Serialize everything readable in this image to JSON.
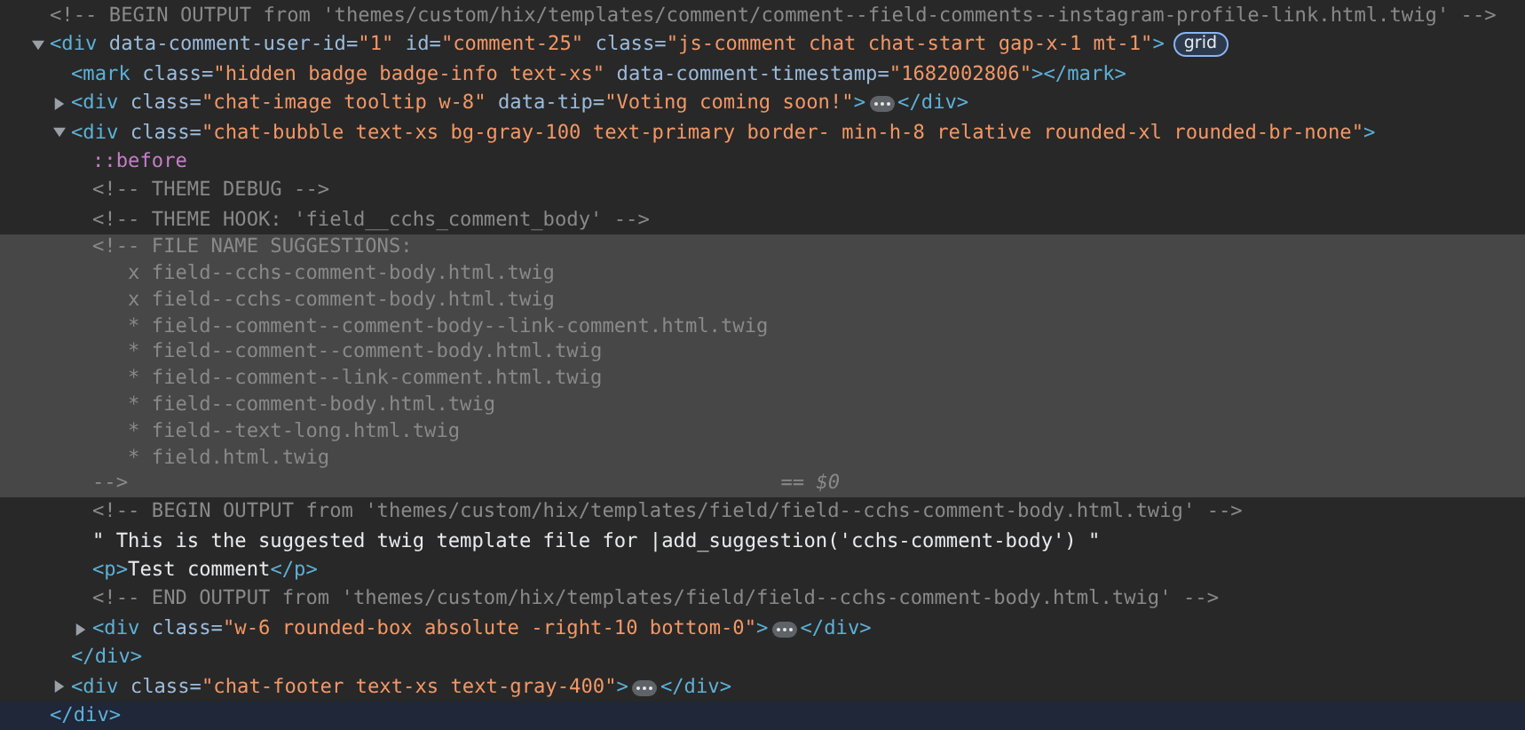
{
  "nodes": [
    {
      "kind": "comment",
      "selected": false,
      "lines": [
        "<!-- BEGIN OUTPUT from 'themes/custom/hix/templates/comment/comment--field-comments--instagram-profile-link.html.twig' -->"
      ]
    },
    {
      "kind": "element",
      "selected": false,
      "expanded": true,
      "badge": "grid",
      "closing_hovered": true,
      "tokens": [
        {
          "kind": "tag",
          "text": "<div"
        },
        {
          "kind": "attr",
          "text": " data-comment-user-id="
        },
        {
          "kind": "value",
          "text": "\"1\""
        },
        {
          "kind": "attr",
          "text": " id="
        },
        {
          "kind": "value",
          "text": "\"comment-25\""
        },
        {
          "kind": "attr",
          "text": " class="
        },
        {
          "kind": "value",
          "text": "\"js-comment chat chat-start gap-x-1 mt-1\""
        },
        {
          "kind": "tag",
          "text": ">"
        }
      ],
      "closing": [
        {
          "kind": "tag",
          "text": "</div>"
        }
      ],
      "children": [
        {
          "kind": "element",
          "selected": false,
          "tokens": [
            {
              "kind": "tag",
              "text": "<mark"
            },
            {
              "kind": "attr",
              "text": " class="
            },
            {
              "kind": "value",
              "text": "\"hidden badge badge-info text-xs\""
            },
            {
              "kind": "attr",
              "text": " data-comment-timestamp="
            },
            {
              "kind": "value",
              "text": "\"1682002806\""
            },
            {
              "kind": "tag",
              "text": "></mark>"
            }
          ]
        },
        {
          "kind": "element",
          "selected": false,
          "expanded": false,
          "tokens": [
            {
              "kind": "tag",
              "text": "<div"
            },
            {
              "kind": "attr",
              "text": " class="
            },
            {
              "kind": "value",
              "text": "\"chat-image tooltip w-8\""
            },
            {
              "kind": "attr",
              "text": " data-tip="
            },
            {
              "kind": "value",
              "text": "\"Voting coming soon!\""
            },
            {
              "kind": "tag",
              "text": ">"
            }
          ],
          "after": [
            {
              "kind": "tag",
              "text": "</div>"
            }
          ]
        },
        {
          "kind": "element",
          "selected": false,
          "expanded": true,
          "tokens": [
            {
              "kind": "tag",
              "text": "<div"
            },
            {
              "kind": "attr",
              "text": " class="
            },
            {
              "kind": "value",
              "text": "\"chat-bubble text-xs bg-gray-100 text-primary border- min-h-8 relative rounded-xl rounded-br-none\""
            },
            {
              "kind": "tag",
              "text": ">"
            }
          ],
          "closing": [
            {
              "kind": "tag",
              "text": "</div>"
            }
          ],
          "children": [
            {
              "kind": "pseudo",
              "selected": false,
              "text": "::before"
            },
            {
              "kind": "comment",
              "selected": false,
              "lines": [
                "<!-- THEME DEBUG -->"
              ]
            },
            {
              "kind": "comment",
              "selected": false,
              "lines": [
                "<!-- THEME HOOK: 'field__cchs_comment_body' -->"
              ]
            },
            {
              "kind": "comment",
              "selected": true,
              "marker": "== $0",
              "lines": [
                "<!-- FILE NAME SUGGESTIONS:",
                "   x field--cchs-comment-body.html.twig",
                "   x field--cchs-comment-body.html.twig",
                "   * field--comment--comment-body--link-comment.html.twig",
                "   * field--comment--comment-body.html.twig",
                "   * field--comment--link-comment.html.twig",
                "   * field--comment-body.html.twig",
                "   * field--text-long.html.twig",
                "   * field.html.twig",
                "-->"
              ]
            },
            {
              "kind": "comment",
              "selected": false,
              "lines": [
                "<!-- BEGIN OUTPUT from 'themes/custom/hix/templates/field/field--cchs-comment-body.html.twig' -->"
              ]
            },
            {
              "kind": "text",
              "selected": false,
              "text": "\" This is the suggested twig template file for |add_suggestion('cchs-comment-body') \""
            },
            {
              "kind": "element",
              "selected": false,
              "tokens": [
                {
                  "kind": "tag",
                  "text": "<p>"
                },
                {
                  "kind": "plain",
                  "text": "Test comment"
                },
                {
                  "kind": "tag",
                  "text": "</p>"
                }
              ]
            },
            {
              "kind": "comment",
              "selected": false,
              "lines": [
                "<!-- END OUTPUT from 'themes/custom/hix/templates/field/field--cchs-comment-body.html.twig' -->"
              ]
            },
            {
              "kind": "element",
              "selected": false,
              "expanded": false,
              "tokens": [
                {
                  "kind": "tag",
                  "text": "<div"
                },
                {
                  "kind": "attr",
                  "text": " class="
                },
                {
                  "kind": "value",
                  "text": "\"w-6 rounded-box absolute -right-10 bottom-0\""
                },
                {
                  "kind": "tag",
                  "text": ">"
                }
              ],
              "after": [
                {
                  "kind": "tag",
                  "text": "</div>"
                }
              ]
            }
          ]
        },
        {
          "kind": "element",
          "selected": false,
          "expanded": false,
          "tokens": [
            {
              "kind": "tag",
              "text": "<div"
            },
            {
              "kind": "attr",
              "text": " class="
            },
            {
              "kind": "value",
              "text": "\"chat-footer text-xs text-gray-400\""
            },
            {
              "kind": "tag",
              "text": ">"
            }
          ],
          "after": [
            {
              "kind": "tag",
              "text": "</div>"
            }
          ]
        }
      ]
    }
  ]
}
